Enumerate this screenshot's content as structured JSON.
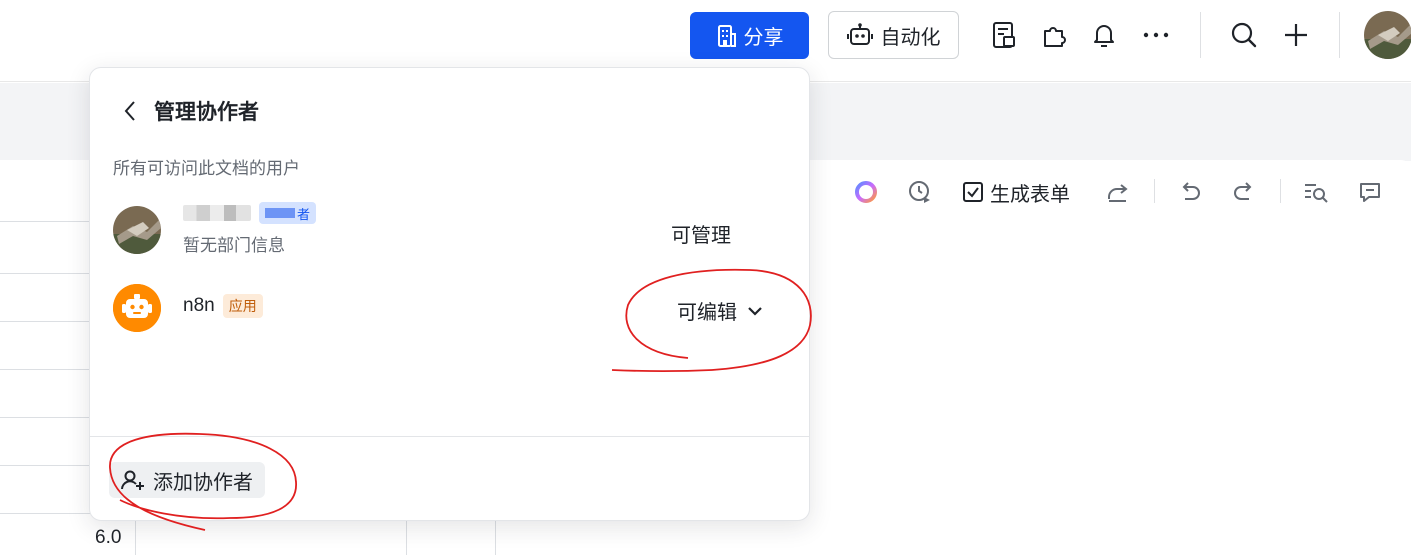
{
  "topbar": {
    "share_label": "分享",
    "automation_label": "自动化",
    "icons": [
      "template-icon",
      "plugin-icon",
      "bell-icon",
      "more-icon",
      "search-icon",
      "plus-icon",
      "avatar"
    ]
  },
  "doc_toolbar": {
    "generate_form_label": "生成表单",
    "icons": [
      "ai-icon",
      "history-icon",
      "form-icon",
      "share-out-icon",
      "undo-icon",
      "redo-icon",
      "find-icon",
      "comment-icon"
    ]
  },
  "table": {
    "visible_cell_value": "6.0"
  },
  "panel": {
    "title": "管理协作者",
    "subtitle": "所有可访问此文档的用户",
    "members": [
      {
        "name_redacted": true,
        "owner_tag": "者",
        "department": "暂无部门信息",
        "permission": "可管理"
      },
      {
        "name": "n8n",
        "tag": "应用",
        "permission": "可编辑"
      }
    ],
    "add_collaborator_label": "添加协作者"
  },
  "colors": {
    "primary": "#1456f0",
    "app_tag_bg": "#fdebd9",
    "app_tag_text": "#c05d0a",
    "robot_avatar": "#ff8a00",
    "annotation": "#e02020"
  }
}
